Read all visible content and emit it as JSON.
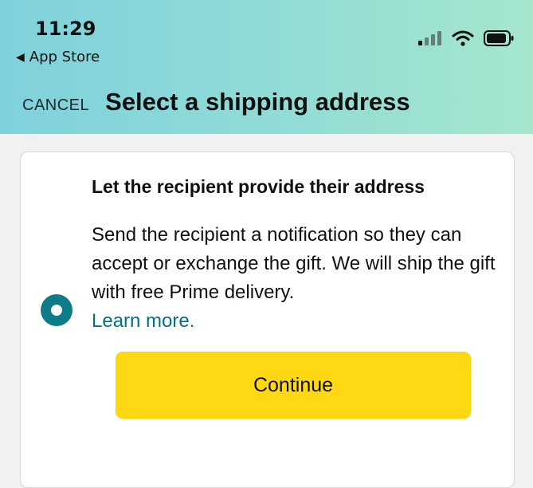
{
  "status_bar": {
    "time": "11:29",
    "back_label": "App Store",
    "icons": [
      "cellular-signal-icon",
      "wifi-icon",
      "battery-icon"
    ]
  },
  "nav": {
    "cancel_label": "CANCEL",
    "title": "Select a shipping address"
  },
  "option": {
    "selected": true,
    "title": "Let the recipient provide their address",
    "description": "Send the recipient a notification so they can accept or exchange the gift. We will ship the gift with free Prime delivery.",
    "learn_more_label": "Learn more."
  },
  "actions": {
    "continue_label": "Continue"
  },
  "colors": {
    "header_start": "#7fd1dc",
    "header_end": "#a6e6cd",
    "radio": "#0e7c86",
    "link": "#007185",
    "button": "#ffd814"
  }
}
